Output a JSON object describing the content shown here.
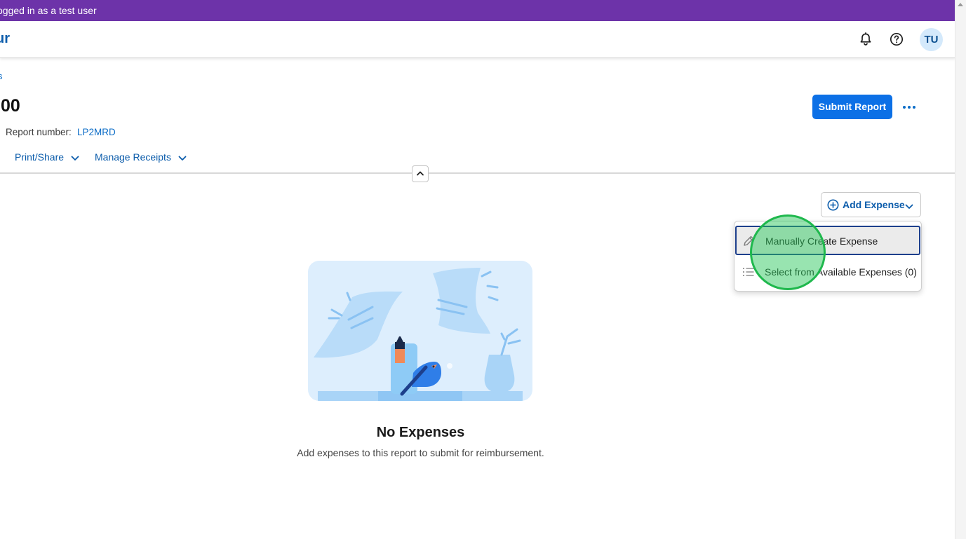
{
  "banner": {
    "text": "ogged in as a test user"
  },
  "header": {
    "app_name": "ur",
    "avatar_initials": "TU",
    "icons": [
      "bell-icon",
      "help-icon"
    ]
  },
  "breadcrumb": {
    "text": "s"
  },
  "report": {
    "amount": ".00",
    "number_label": "Report number:",
    "number": "LP2MRD"
  },
  "actions": {
    "submit_label": "Submit Report",
    "print_share_label": "Print/Share",
    "manage_receipts_label": "Manage Receipts"
  },
  "add_expense": {
    "label": "Add Expense",
    "menu": [
      {
        "label": "Manually Create Expense",
        "icon": "pencil-icon",
        "highlighted": true
      },
      {
        "label": "Select from Available Expenses (0)",
        "icon": "list-icon",
        "highlighted": false
      }
    ]
  },
  "empty_state": {
    "title": "No Expenses",
    "subtitle": "Add expenses to this report to submit for reimbursement."
  },
  "colors": {
    "banner": "#6d33a9",
    "primary": "#0c70e6",
    "link": "#0b6cc7",
    "avatar_bg": "#d4e9fb",
    "click_marker": "#1fb84d"
  }
}
